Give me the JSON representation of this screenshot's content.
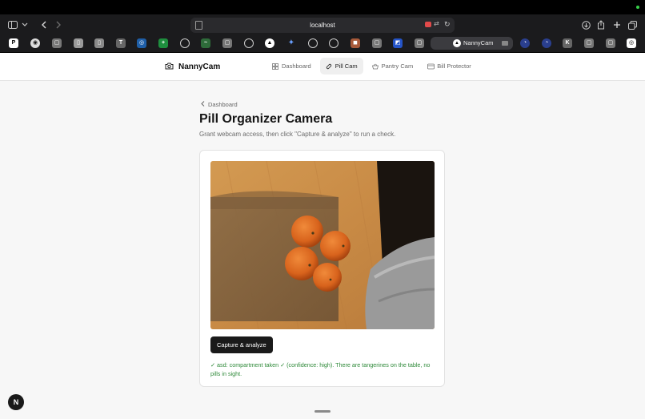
{
  "browser": {
    "url": "localhost",
    "active_tab_label": "NannyCam"
  },
  "app": {
    "brand": "NannyCam",
    "nav": [
      {
        "label": "Dashboard",
        "icon": "grid-icon",
        "active": false
      },
      {
        "label": "Pill Cam",
        "icon": "pill-icon",
        "active": true
      },
      {
        "label": "Pantry Cam",
        "icon": "basket-icon",
        "active": false
      },
      {
        "label": "Bill Protector",
        "icon": "card-icon",
        "active": false
      }
    ]
  },
  "page": {
    "back_label": "Dashboard",
    "title": "Pill Organizer Camera",
    "subtitle": "Grant webcam access, then click \"Capture & analyze\" to run a check.",
    "capture_button": "Capture & analyze",
    "result_text": "✓ asd: compartment taken ✓ (confidence: high). There are tangerines on the table, no pills in sight."
  },
  "colors": {
    "success": "#2f8a3a",
    "button_bg": "#1a1a1a"
  }
}
